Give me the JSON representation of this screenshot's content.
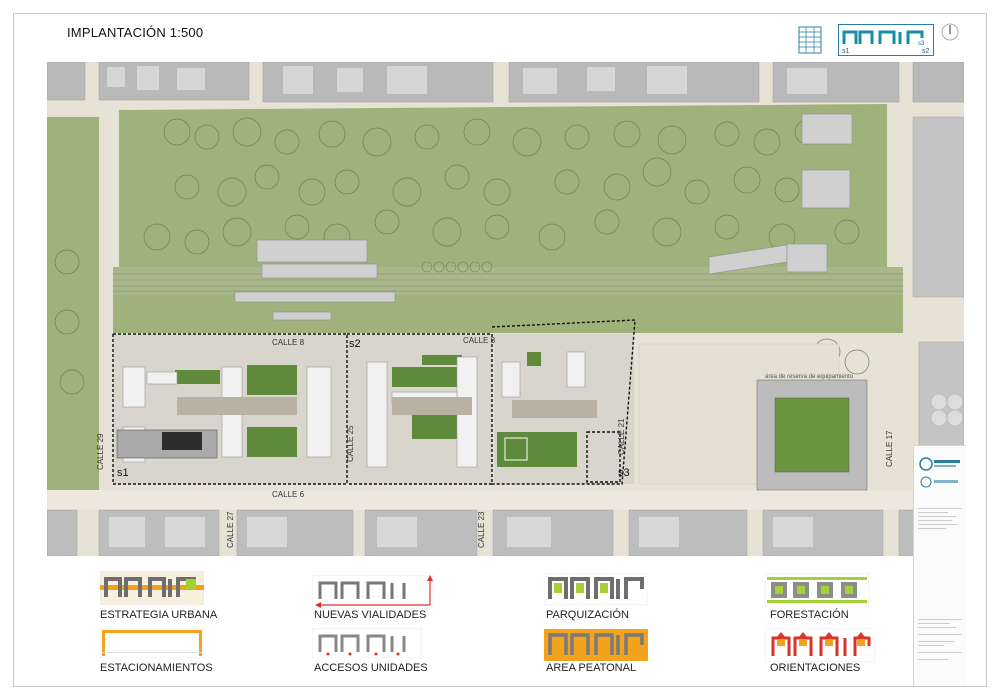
{
  "title": "IMPLANTACIÓN 1:500",
  "header_icons": [
    "building-grid-icon",
    "sector-plan-icon",
    "north-arrow-icon"
  ],
  "header_plan_labels": [
    "s1",
    "s2",
    "s3"
  ],
  "plan": {
    "streets": [
      "CALLE 8",
      "CALLE 8",
      "CALLE 6",
      "CALLE 29",
      "CALLE 25",
      "CALLE 21",
      "CALLE 27",
      "CALLE 23",
      "CALLE 17"
    ],
    "sectors": [
      "s1",
      "s2",
      "s3"
    ],
    "reserve_area": "área de reserva de equipamiento"
  },
  "legend": [
    {
      "label": "ESTRATEGIA URBANA"
    },
    {
      "label": "NUEVAS VIALIDADES"
    },
    {
      "label": "PARQUIZACIÓN"
    },
    {
      "label": "FORESTACIÓN"
    },
    {
      "label": "ESTACIONAMIENTOS"
    },
    {
      "label": "ACCESOS UNIDADES"
    },
    {
      "label": "AREA PEATONAL"
    },
    {
      "label": "ORIENTACIONES"
    }
  ],
  "colors": {
    "park_green": "#9fb27c",
    "dark_green": "#5f8a3c",
    "road": "#e7e2d6",
    "block_grey": "#bdbdbd",
    "urban_orange": "#f2a31b",
    "route_red": "#d9342a",
    "lime": "#a4d233",
    "accent_teal": "#1a8fa3"
  }
}
